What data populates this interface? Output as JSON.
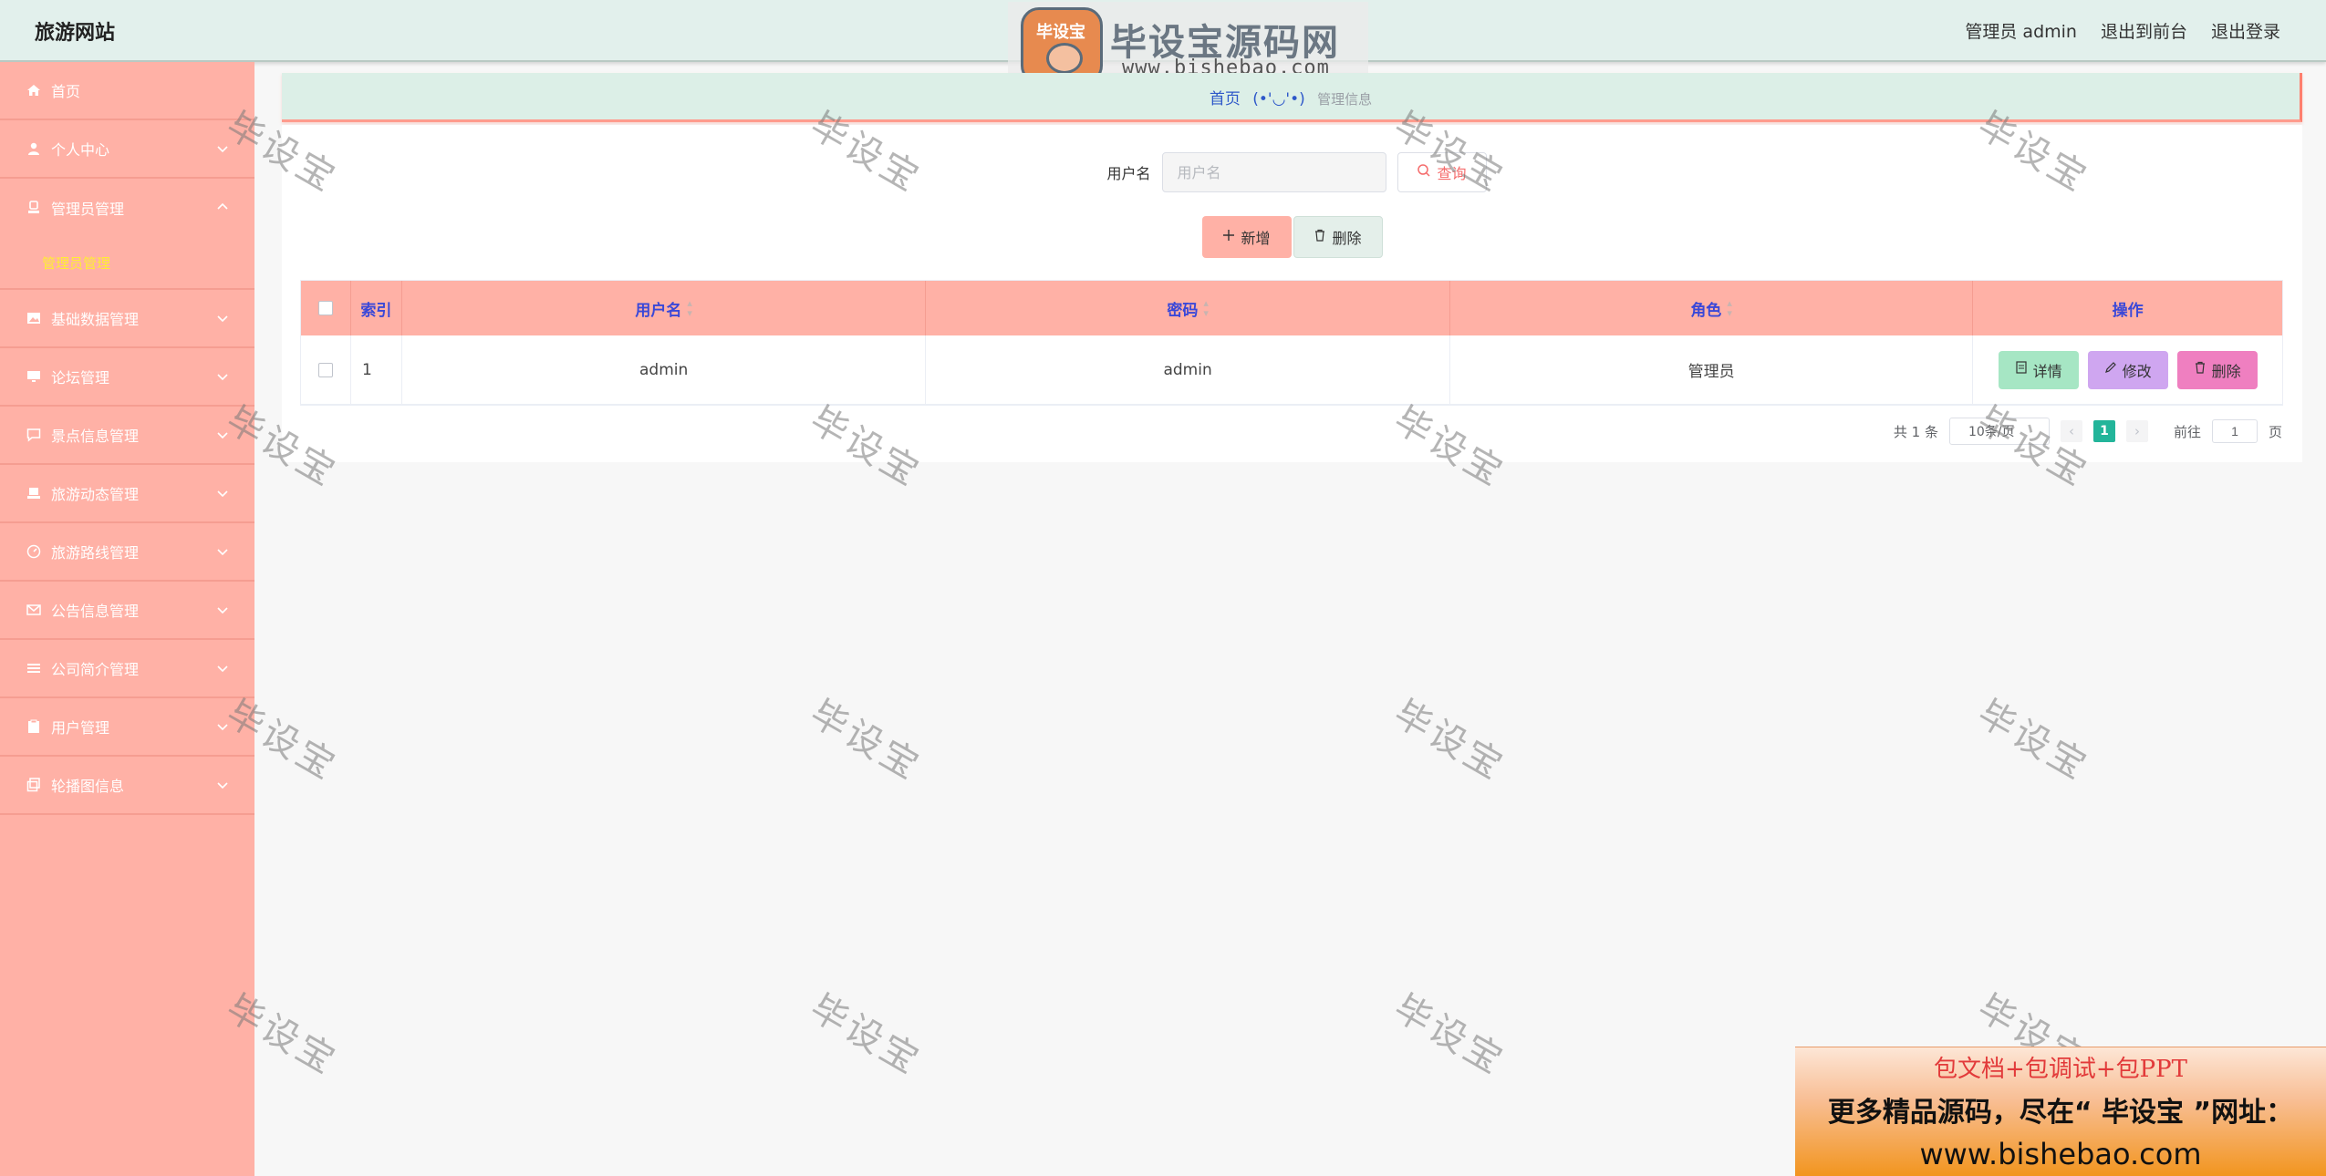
{
  "header": {
    "site_title": "旅游网站",
    "user_label": "管理员 admin",
    "front_link": "退出到前台",
    "logout_link": "退出登录"
  },
  "logo_watermark": {
    "badge_text": "毕设宝",
    "name": "毕设宝源码网",
    "url": "www.bishebao.com"
  },
  "sidebar": {
    "items": [
      {
        "label": "首页",
        "icon": "home-icon",
        "has_chevron": false
      },
      {
        "label": "个人中心",
        "icon": "user-icon",
        "has_chevron": true
      },
      {
        "label": "管理员管理",
        "icon": "stamp-icon",
        "has_chevron": true,
        "expanded": true,
        "children": [
          {
            "label": "管理员管理",
            "active": true
          }
        ]
      },
      {
        "label": "基础数据管理",
        "icon": "picture-icon",
        "has_chevron": true
      },
      {
        "label": "论坛管理",
        "icon": "monitor-icon",
        "has_chevron": true
      },
      {
        "label": "景点信息管理",
        "icon": "chat-icon",
        "has_chevron": true
      },
      {
        "label": "旅游动态管理",
        "icon": "laptop-icon",
        "has_chevron": true
      },
      {
        "label": "旅游路线管理",
        "icon": "gauge-icon",
        "has_chevron": true
      },
      {
        "label": "公告信息管理",
        "icon": "mail-icon",
        "has_chevron": true
      },
      {
        "label": "公司简介管理",
        "icon": "list-icon",
        "has_chevron": true
      },
      {
        "label": "用户管理",
        "icon": "clipboard-icon",
        "has_chevron": true
      },
      {
        "label": "轮播图信息",
        "icon": "copy-icon",
        "has_chevron": true
      }
    ]
  },
  "breadcrumb": {
    "home": "首页",
    "separator": "(•'◡'•)",
    "current": "管理信息"
  },
  "search": {
    "label": "用户名",
    "placeholder": "用户名",
    "button": "查询"
  },
  "actions": {
    "add": "新增",
    "delete": "删除"
  },
  "table": {
    "columns": [
      "索引",
      "用户名",
      "密码",
      "角色",
      "操作"
    ],
    "rows": [
      {
        "index": "1",
        "username": "admin",
        "password": "admin",
        "role": "管理员"
      }
    ],
    "row_actions": {
      "detail": "详情",
      "edit": "修改",
      "delete": "删除"
    }
  },
  "pagination": {
    "total": "共 1 条",
    "page_size": "10条/页",
    "current_page": "1",
    "goto_prefix": "前往",
    "goto_value": "1",
    "goto_suffix": "页"
  },
  "watermark_text": "毕设宝",
  "promo": {
    "line1": "包文档+包调试+包PPT",
    "line2": "更多精品源码，尽在“ 毕设宝 ”网址：",
    "line3": "www.bishebao.com"
  },
  "colors": {
    "header_bg": "#e2f0ec",
    "sidebar_bg": "#ffb1a6",
    "table_header_bg": "#ffb1a6",
    "header_text": "#3a48d8",
    "active_submenu": "#ffee33",
    "pagination_active": "#23b59a"
  }
}
